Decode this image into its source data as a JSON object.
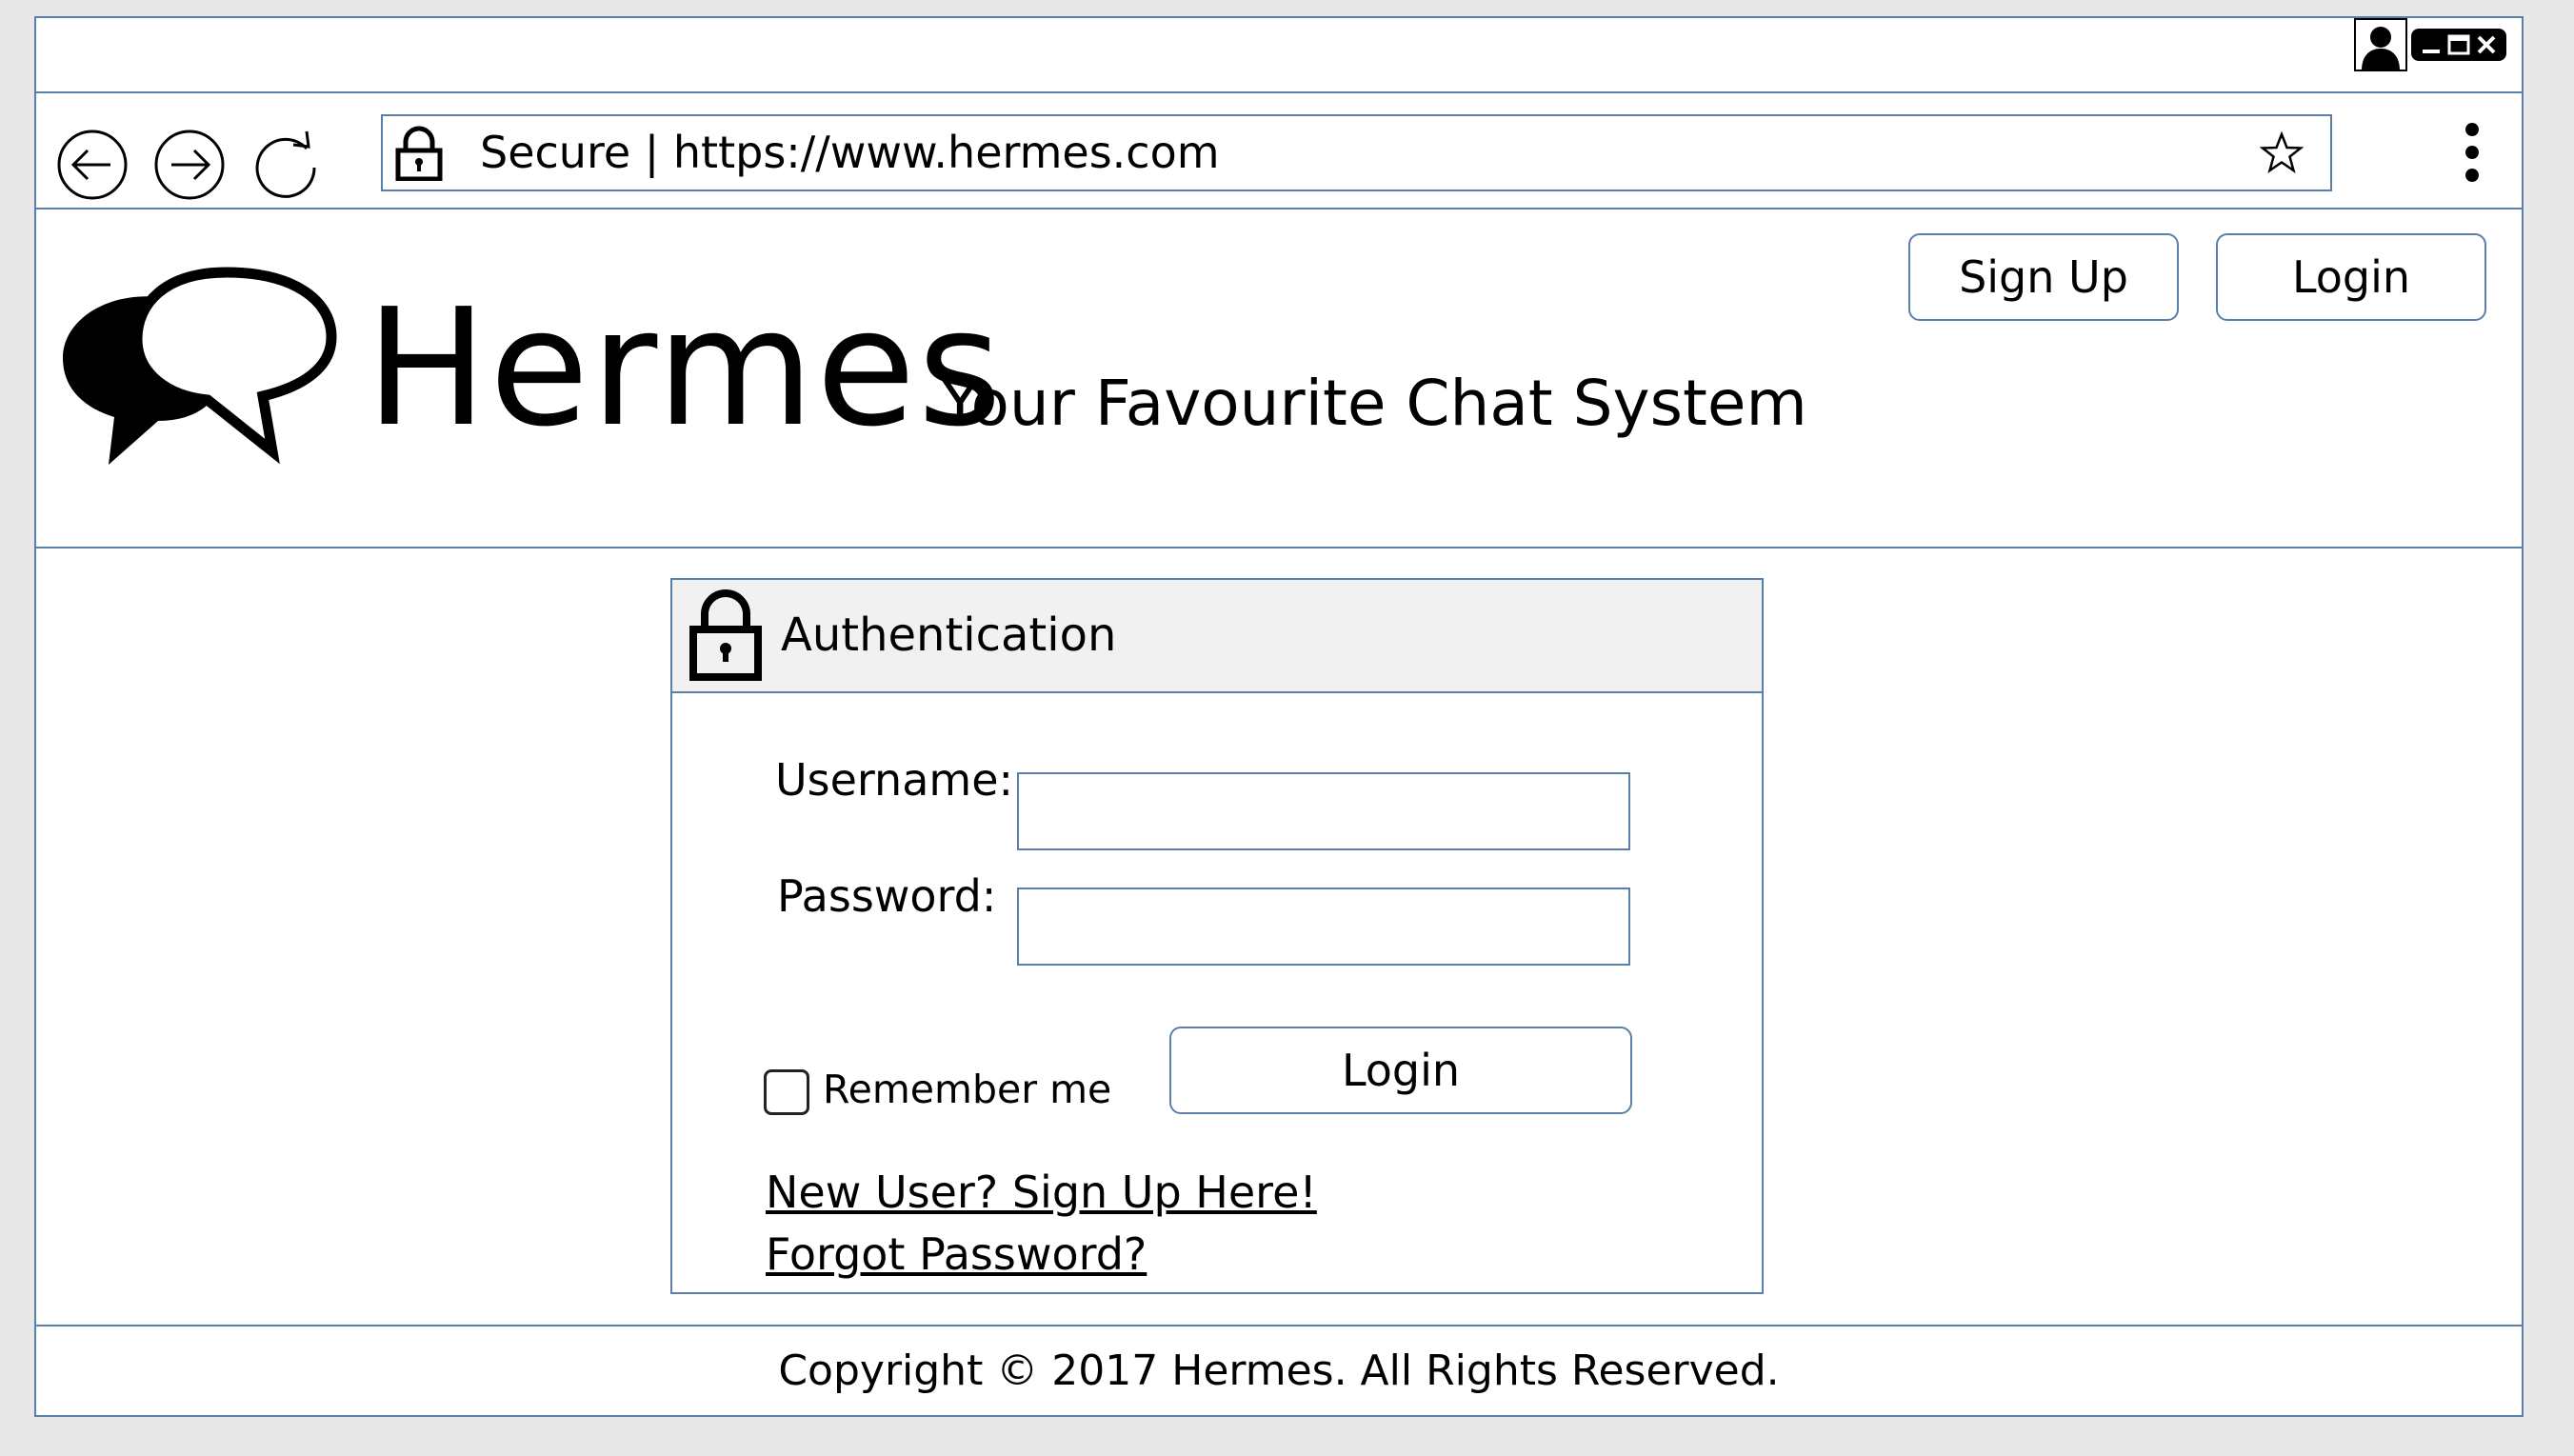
{
  "browser": {
    "address": "Secure | https://www.hermes.com",
    "icons": [
      "back-arrow-icon",
      "forward-arrow-icon",
      "refresh-icon",
      "lock-icon",
      "star-icon",
      "more-vertical-icon",
      "user-icon",
      "minimize-icon",
      "maximize-icon",
      "close-icon"
    ]
  },
  "header": {
    "brand": "Hermes",
    "tagline": "Your Favourite Chat System",
    "signup_label": "Sign Up",
    "login_label": "Login"
  },
  "auth": {
    "title": "Authentication",
    "username_label": "Username:",
    "username_value": "",
    "password_label": "Password:",
    "password_value": "",
    "remember_label": "Remember me",
    "remember_checked": false,
    "login_label": "Login",
    "signup_link": "New User? Sign Up Here!",
    "forgot_link": "Forgot Password?"
  },
  "footer": {
    "copyright": "Copyright © 2017 Hermes. All Rights Reserved."
  },
  "colors": {
    "border": "#5a7fa8",
    "panel_header_bg": "#f1f1f1",
    "page_bg": "#e8e8e8"
  }
}
